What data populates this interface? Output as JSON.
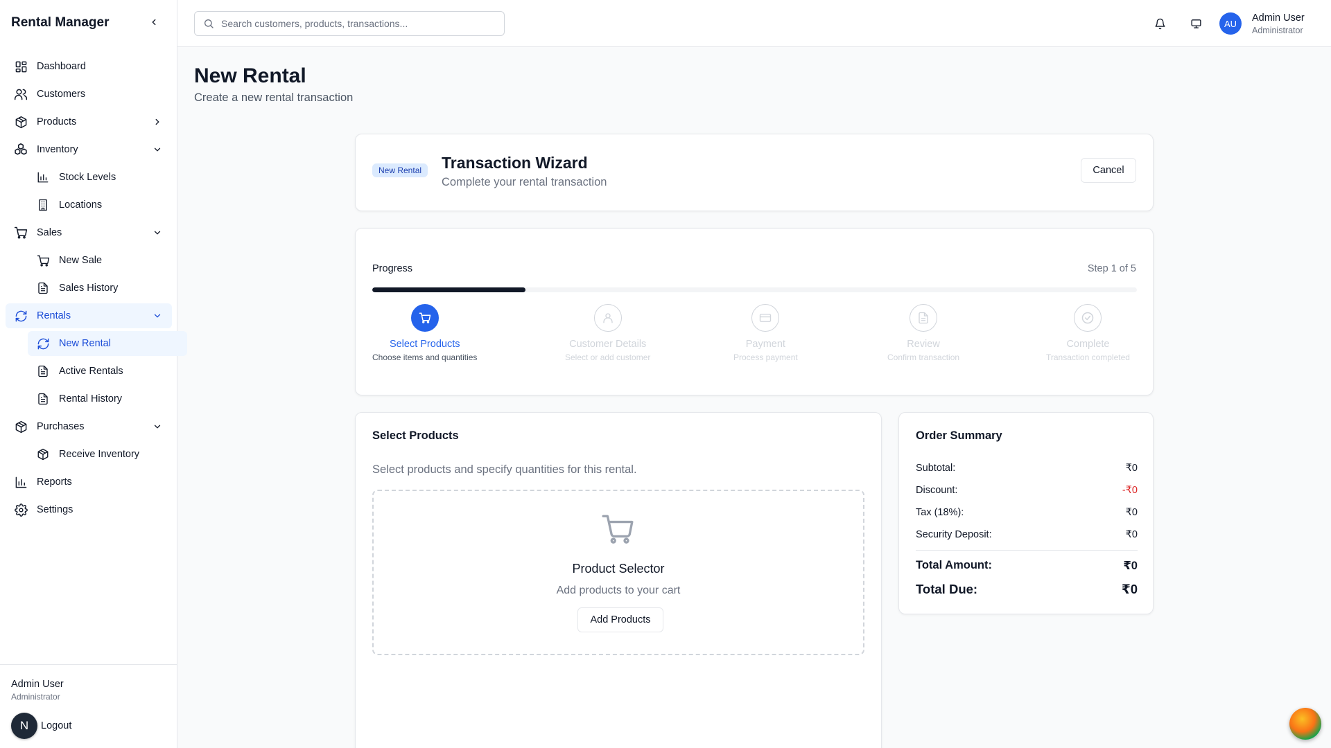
{
  "app": {
    "title": "Rental Manager"
  },
  "sidebar": {
    "items": [
      {
        "label": "Dashboard",
        "icon": "dashboard-icon"
      },
      {
        "label": "Customers",
        "icon": "users-icon"
      },
      {
        "label": "Products",
        "icon": "package-icon"
      },
      {
        "label": "Inventory",
        "icon": "boxes-icon"
      },
      {
        "label": "Stock Levels",
        "icon": "bar-chart-icon"
      },
      {
        "label": "Locations",
        "icon": "building-icon"
      },
      {
        "label": "Sales",
        "icon": "cart-icon"
      },
      {
        "label": "New Sale",
        "icon": "cart-icon"
      },
      {
        "label": "Sales History",
        "icon": "document-icon"
      },
      {
        "label": "Rentals",
        "icon": "refresh-icon"
      },
      {
        "label": "New Rental",
        "icon": "refresh-icon"
      },
      {
        "label": "Active Rentals",
        "icon": "document-icon"
      },
      {
        "label": "Rental History",
        "icon": "document-icon"
      },
      {
        "label": "Purchases",
        "icon": "package-icon"
      },
      {
        "label": "Receive Inventory",
        "icon": "package-icon"
      },
      {
        "label": "Reports",
        "icon": "bar-chart-icon"
      },
      {
        "label": "Settings",
        "icon": "gear-icon"
      }
    ],
    "footer": {
      "user_name": "Admin User",
      "user_role": "Administrator",
      "avatar_initial": "N",
      "logout_label": "Logout"
    }
  },
  "header": {
    "search_placeholder": "Search customers, products, transactions...",
    "avatar_initials": "AU",
    "user_name": "Admin User",
    "user_role": "Administrator"
  },
  "page": {
    "title": "New Rental",
    "subtitle": "Create a new rental transaction"
  },
  "wizard": {
    "badge": "New Rental",
    "title": "Transaction Wizard",
    "subtitle": "Complete your rental transaction",
    "cancel_label": "Cancel"
  },
  "progress": {
    "label": "Progress",
    "step_text": "Step 1 of 5",
    "fraction": 0.2,
    "steps": [
      {
        "title": "Select Products",
        "desc": "Choose items and quantities",
        "icon": "cart-icon",
        "active": true
      },
      {
        "title": "Customer Details",
        "desc": "Select or add customer",
        "icon": "user-icon",
        "active": false
      },
      {
        "title": "Payment",
        "desc": "Process payment",
        "icon": "credit-card-icon",
        "active": false
      },
      {
        "title": "Review",
        "desc": "Confirm transaction",
        "icon": "document-icon",
        "active": false
      },
      {
        "title": "Complete",
        "desc": "Transaction completed",
        "icon": "check-circle-icon",
        "active": false
      }
    ]
  },
  "products": {
    "title": "Select Products",
    "subtitle": "Select products and specify quantities for this rental.",
    "selector_title": "Product Selector",
    "selector_sub": "Add products to your cart",
    "add_label": "Add Products"
  },
  "summary": {
    "title": "Order Summary",
    "subtotal_label": "Subtotal:",
    "subtotal": "₹0",
    "discount_label": "Discount:",
    "discount": "-₹0",
    "tax_label": "Tax (18%):",
    "tax": "₹0",
    "deposit_label": "Security Deposit:",
    "deposit": "₹0",
    "total_label": "Total Amount:",
    "total": "₹0",
    "due_label": "Total Due:",
    "due": "₹0"
  },
  "colors": {
    "accent": "#2563eb",
    "active_bg": "#eff6ff",
    "negative": "#dc2626"
  }
}
